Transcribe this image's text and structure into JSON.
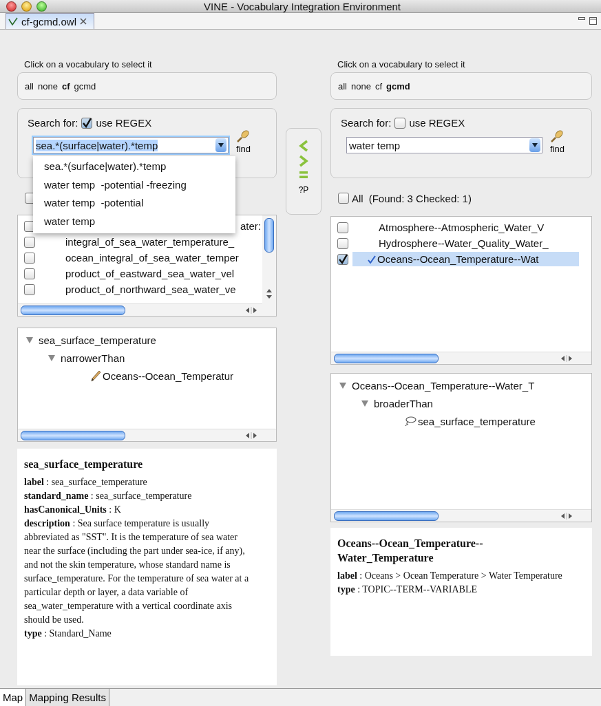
{
  "window": {
    "title": "VINE - Vocabulary Integration Environment"
  },
  "editor_tab": {
    "label": "cf-gcmd.owl",
    "selected": true
  },
  "panes": [
    {
      "vocab_prompt": "Click on a vocabulary to select it",
      "vocabularies": [
        {
          "label": "all",
          "selected": false
        },
        {
          "label": "none",
          "selected": false
        },
        {
          "label": "cf",
          "selected": true
        },
        {
          "label": "gcmd",
          "selected": false
        }
      ],
      "search_label": "Search for:",
      "regex": {
        "label": "use REGEX",
        "checked": true
      },
      "query": "sea.*(surface|water).*temp",
      "query_selected": true,
      "find_label": "find",
      "dropdown": [
        "sea.*(surface|water).*temp",
        "water temp  -potential -freezing",
        "water temp  -potential",
        "water temp"
      ],
      "all": {
        "checked": false
      },
      "results": [
        {
          "label": "ater:",
          "checked": false,
          "selected": false,
          "kind": "covered"
        },
        {
          "label": "integral_of_sea_water_temperature_",
          "checked": false,
          "selected": false,
          "kind": "plain"
        },
        {
          "label": "ocean_integral_of_sea_water_temper",
          "checked": false,
          "selected": false,
          "kind": "plain"
        },
        {
          "label": "product_of_eastward_sea_water_vel",
          "checked": false,
          "selected": false,
          "kind": "plain"
        },
        {
          "label": "product_of_northward_sea_water_ve",
          "checked": false,
          "selected": false,
          "kind": "plain"
        }
      ],
      "tree": {
        "label": "sea_surface_temperature",
        "expanded": true,
        "children": [
          {
            "label": "narrowerThan",
            "expanded": true,
            "children": [
              {
                "label": "Oceans--Ocean_Temperatur",
                "kind": "pencil"
              }
            ]
          }
        ]
      },
      "details": {
        "title": "sea_surface_temperature",
        "lines": [
          "**label** : sea_surface_temperature",
          "**standard_name** : sea_surface_temperature",
          "**hasCanonical_Units** : K",
          "**description** : Sea surface temperature is usually abbreviated as \"SST\". It is the temperature of sea water near the surface (including the part under sea-ice, if any), and not the skin temperature, whose standard name is surface_temperature. For the temperature of sea water at a particular depth or layer, a data variable of sea_water_temperature with a vertical coordinate axis should be used.",
          "**type** : Standard_Name"
        ]
      }
    },
    {
      "vocab_prompt": "Click on a vocabulary to select it",
      "vocabularies": [
        {
          "label": "all",
          "selected": false
        },
        {
          "label": "none",
          "selected": false
        },
        {
          "label": "cf",
          "selected": false
        },
        {
          "label": "gcmd",
          "selected": true
        }
      ],
      "search_label": "Search for:",
      "regex": {
        "label": "use REGEX",
        "checked": false
      },
      "query": "water temp",
      "query_selected": false,
      "find_label": "find",
      "all": {
        "label": "All",
        "checked": false
      },
      "summary": "(Found: 3 Checked: 1)",
      "results": [
        {
          "label": "Atmosphere--Atmospheric_Water_V",
          "checked": false,
          "selected": false,
          "kind": "plain"
        },
        {
          "label": "Hydrosphere--Water_Quality_Water_",
          "checked": false,
          "selected": false,
          "kind": "plain"
        },
        {
          "label": "Oceans--Ocean_Temperature--Wat",
          "checked": true,
          "selected": true,
          "kind": "plain"
        }
      ],
      "tree": {
        "label": "Oceans--Ocean_Temperature--Water_T",
        "expanded": true,
        "children": [
          {
            "label": "broaderThan",
            "expanded": true,
            "children": [
              {
                "label": "sea_surface_temperature",
                "kind": "lasso"
              }
            ]
          }
        ]
      },
      "details": {
        "title": "Oceans--Ocean_Temperature--Water_Temperature",
        "lines": [
          "**label** : Oceans > Ocean Temperature > Water Temperature",
          "**type** : TOPIC--TERM--VARIABLE"
        ]
      }
    }
  ],
  "transfer_buttons": [
    {
      "kind": "left"
    },
    {
      "kind": "right"
    },
    {
      "kind": "equal"
    },
    {
      "kind": "text",
      "label": "?P"
    }
  ],
  "bottom_tabs": [
    {
      "label": "Map",
      "selected": true
    },
    {
      "label": "Mapping Results",
      "selected": false
    }
  ]
}
